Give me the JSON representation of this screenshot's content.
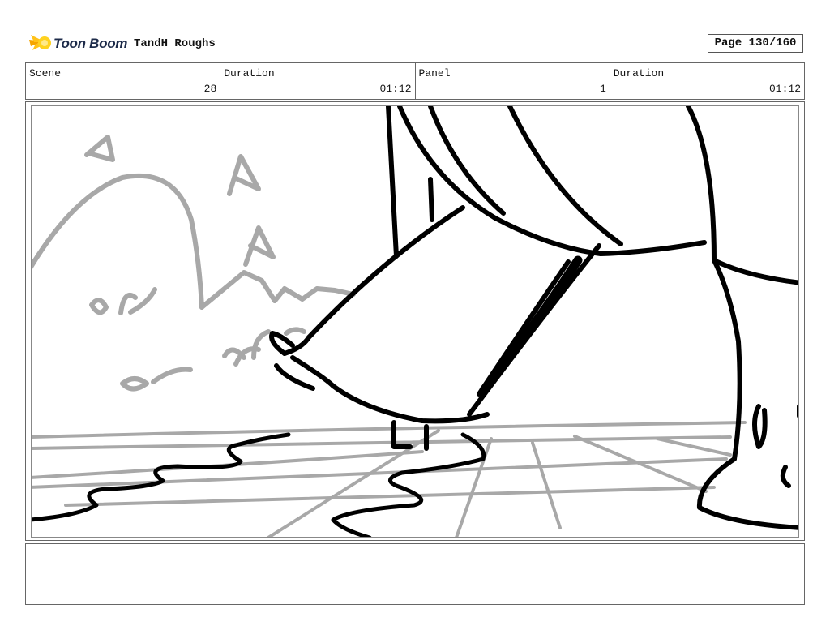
{
  "header": {
    "logo_text": "Toon Boom",
    "project_title": "TandH Roughs",
    "page_label": "Page 130/160"
  },
  "info": {
    "scene_label": "Scene",
    "scene_value": "28",
    "scene_duration_label": "Duration",
    "scene_duration_value": "01:12",
    "panel_label": "Panel",
    "panel_value": "1",
    "panel_duration_label": "Duration",
    "panel_duration_value": "01:12"
  },
  "notes": {
    "text": ""
  }
}
